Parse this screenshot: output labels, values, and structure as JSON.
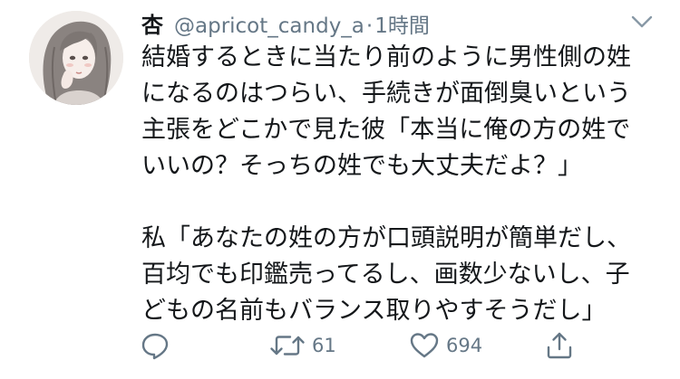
{
  "tweet": {
    "display_name": "杏",
    "handle": "@apricot_candy_a",
    "separator": "·",
    "time": "1時間",
    "paragraphs": [
      "結婚するときに当たり前のように男性側の姓\nになるのはつらい、手続きが面倒臭いという\n主張をどこかで見た彼「本当に俺の方の姓で\nいいの？そっちの姓でも大丈夫だよ？」",
      "私「あなたの姓の方が口頭説明が簡単だし、\n百均でも印鑑売ってるし、画数少ないし、子\nどもの名前もバランス取りやすそうだし」"
    ]
  },
  "actions": {
    "reply": {
      "icon": "reply-icon",
      "count": ""
    },
    "retweet": {
      "icon": "retweet-icon",
      "count": "61"
    },
    "like": {
      "icon": "heart-icon",
      "count": "694"
    },
    "share": {
      "icon": "share-icon",
      "count": ""
    }
  },
  "colors": {
    "text": "#14171a",
    "secondary": "#657786",
    "background": "#ffffff"
  }
}
